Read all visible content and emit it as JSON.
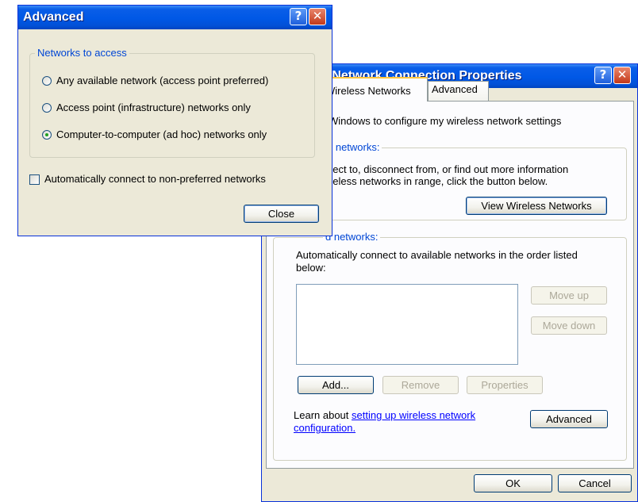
{
  "back_window": {
    "title": "s Network Connection Properties",
    "help_label": "?",
    "close_label": "✕",
    "tabs": [
      {
        "label": "Wireless Networks",
        "active": true
      },
      {
        "label": "Advanced",
        "active": false
      }
    ],
    "use_windows_text": "Windows to configure my wireless network settings",
    "available": {
      "legend": "e networks:",
      "description_line1": "nect to, disconnect from, or find out more information",
      "description_line2": "ireless networks in range, click the button below.",
      "view_button": "View Wireless Networks"
    },
    "preferred": {
      "legend": "d networks:",
      "description_line1": "Automatically connect to available networks in the order listed",
      "description_line2": "below:",
      "move_up": "Move up",
      "move_down": "Move down",
      "add": "Add...",
      "remove": "Remove",
      "properties": "Properties"
    },
    "learn_prefix": "Learn about",
    "learn_link_line1": "setting up wireless network",
    "learn_link_line2": "configuration.",
    "advanced_button": "Advanced",
    "ok_button": "OK",
    "cancel_button": "Cancel"
  },
  "front_dialog": {
    "title": "Advanced",
    "help_label": "?",
    "close_label": "✕",
    "group_legend": "Networks to access",
    "options": [
      {
        "label": "Any available network (access point preferred)",
        "checked": false
      },
      {
        "label": "Access point (infrastructure) networks only",
        "checked": false
      },
      {
        "label": "Computer-to-computer (ad hoc) networks only",
        "checked": true
      }
    ],
    "auto_connect_label": "Automatically connect to non-preferred networks",
    "auto_connect_checked": false,
    "close_button": "Close"
  }
}
